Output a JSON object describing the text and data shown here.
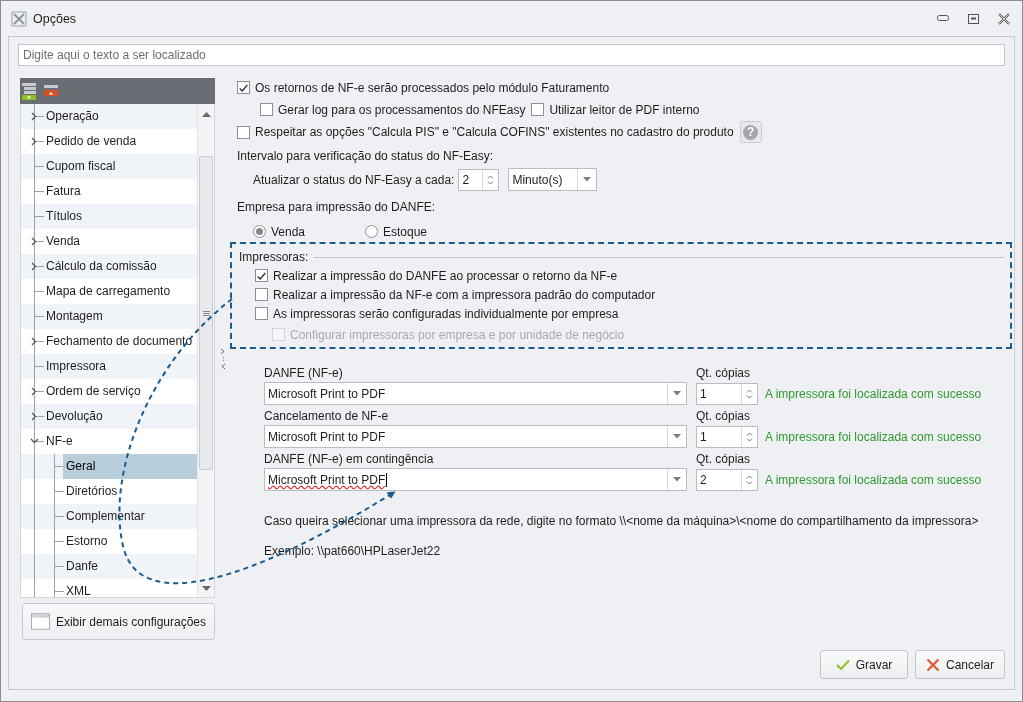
{
  "window": {
    "title": "Opções"
  },
  "search": {
    "placeholder": "Digite aqui o texto a ser localizado"
  },
  "sidebar": {
    "tree": [
      {
        "label": "Operação",
        "expanded": false,
        "selected": false
      },
      {
        "label": "Pedido de venda",
        "expanded": false,
        "selected": false
      },
      {
        "label": "Cupom fiscal",
        "selected": false
      },
      {
        "label": "Fatura",
        "selected": false
      },
      {
        "label": "Títulos",
        "selected": false
      },
      {
        "label": "Venda",
        "expanded": false,
        "selected": false
      },
      {
        "label": "Cálculo da comissão",
        "expanded": false,
        "selected": false
      },
      {
        "label": "Mapa de carregamento",
        "selected": false
      },
      {
        "label": "Montagem",
        "selected": false
      },
      {
        "label": "Fechamento de documento",
        "expanded": false,
        "selected": false
      },
      {
        "label": "Impressora",
        "selected": false
      },
      {
        "label": "Ordem de serviço",
        "expanded": false,
        "selected": false
      },
      {
        "label": "Devolução",
        "expanded": false,
        "selected": false
      },
      {
        "label": "NF-e",
        "expanded": true,
        "selected": false,
        "children": [
          {
            "label": "Geral",
            "selected": true
          },
          {
            "label": "Diretórios",
            "selected": false
          },
          {
            "label": "Complementar",
            "selected": false
          },
          {
            "label": "Estorno",
            "selected": false
          },
          {
            "label": "Danfe",
            "selected": false
          },
          {
            "label": "XML",
            "selected": false
          }
        ]
      }
    ],
    "more_button": "Exibir demais configurações"
  },
  "general": {
    "return_processing": {
      "label": "Os retornos de NF-e serão processados pelo módulo Faturamento",
      "checked": true
    },
    "sub_options": [
      {
        "label": "Gerar log para os processamentos do NFEasy",
        "checked": false
      },
      {
        "label": "Utilizar leitor de PDF interno",
        "checked": false
      }
    ],
    "respect_taxes": {
      "label": "Respeitar as opções \"Calcula PIS\" e \"Calcula COFINS\" existentes no cadastro do produto",
      "checked": false,
      "help": "?"
    },
    "interval": {
      "heading": "Intervalo para verificação do status do NF-Easy:",
      "label": "Atualizar o status do NF-Easy a cada:",
      "value": "2",
      "unit": "Minuto(s)"
    },
    "company": {
      "heading": "Empresa para impressão do DANFE:",
      "options": [
        {
          "label": "Venda",
          "selected": true
        },
        {
          "label": "Estoque",
          "selected": false
        }
      ]
    }
  },
  "printers": {
    "heading": "Impressoras:",
    "options": [
      {
        "label": "Realizar a impressão do DANFE ao processar o retorno da NF-e",
        "checked": true,
        "disabled": false
      },
      {
        "label": "Realizar a impressão da NF-e com a impressora padrão do computador",
        "checked": false,
        "disabled": false
      },
      {
        "label": "As impressoras serão configuradas individualmente por empresa",
        "checked": false,
        "disabled": false
      },
      {
        "label": "Configurar impressoras por empresa e por unidade de negócio",
        "checked": false,
        "disabled": true
      }
    ],
    "rows": [
      {
        "label": "DANFE (NF-e)",
        "printer": "Microsoft Print to PDF",
        "copies_label": "Qt. cópias",
        "copies": "1",
        "status": "A impressora foi localizada com sucesso",
        "focused": false
      },
      {
        "label": "Cancelamento de NF-e",
        "printer": "Microsoft Print to PDF",
        "copies_label": "Qt. cópias",
        "copies": "1",
        "status": "A impressora foi localizada com sucesso",
        "focused": false
      },
      {
        "label": "DANFE (NF-e) em contingência",
        "printer": "Microsoft Print to PDF",
        "copies_label": "Qt. cópias",
        "copies": "2",
        "status": "A impressora foi localizada com sucesso",
        "focused": true
      }
    ],
    "note": "Caso queira selecionar uma impressora da rede, digite no formato \\\\<nome da máquina>\\<nome do compartilhamento da impressora>",
    "example": "Exemplo: \\\\pat660\\HPLaserJet22"
  },
  "buttons": [
    {
      "label": "Gravar",
      "kind": "save"
    },
    {
      "label": "Cancelar",
      "kind": "cancel"
    }
  ]
}
